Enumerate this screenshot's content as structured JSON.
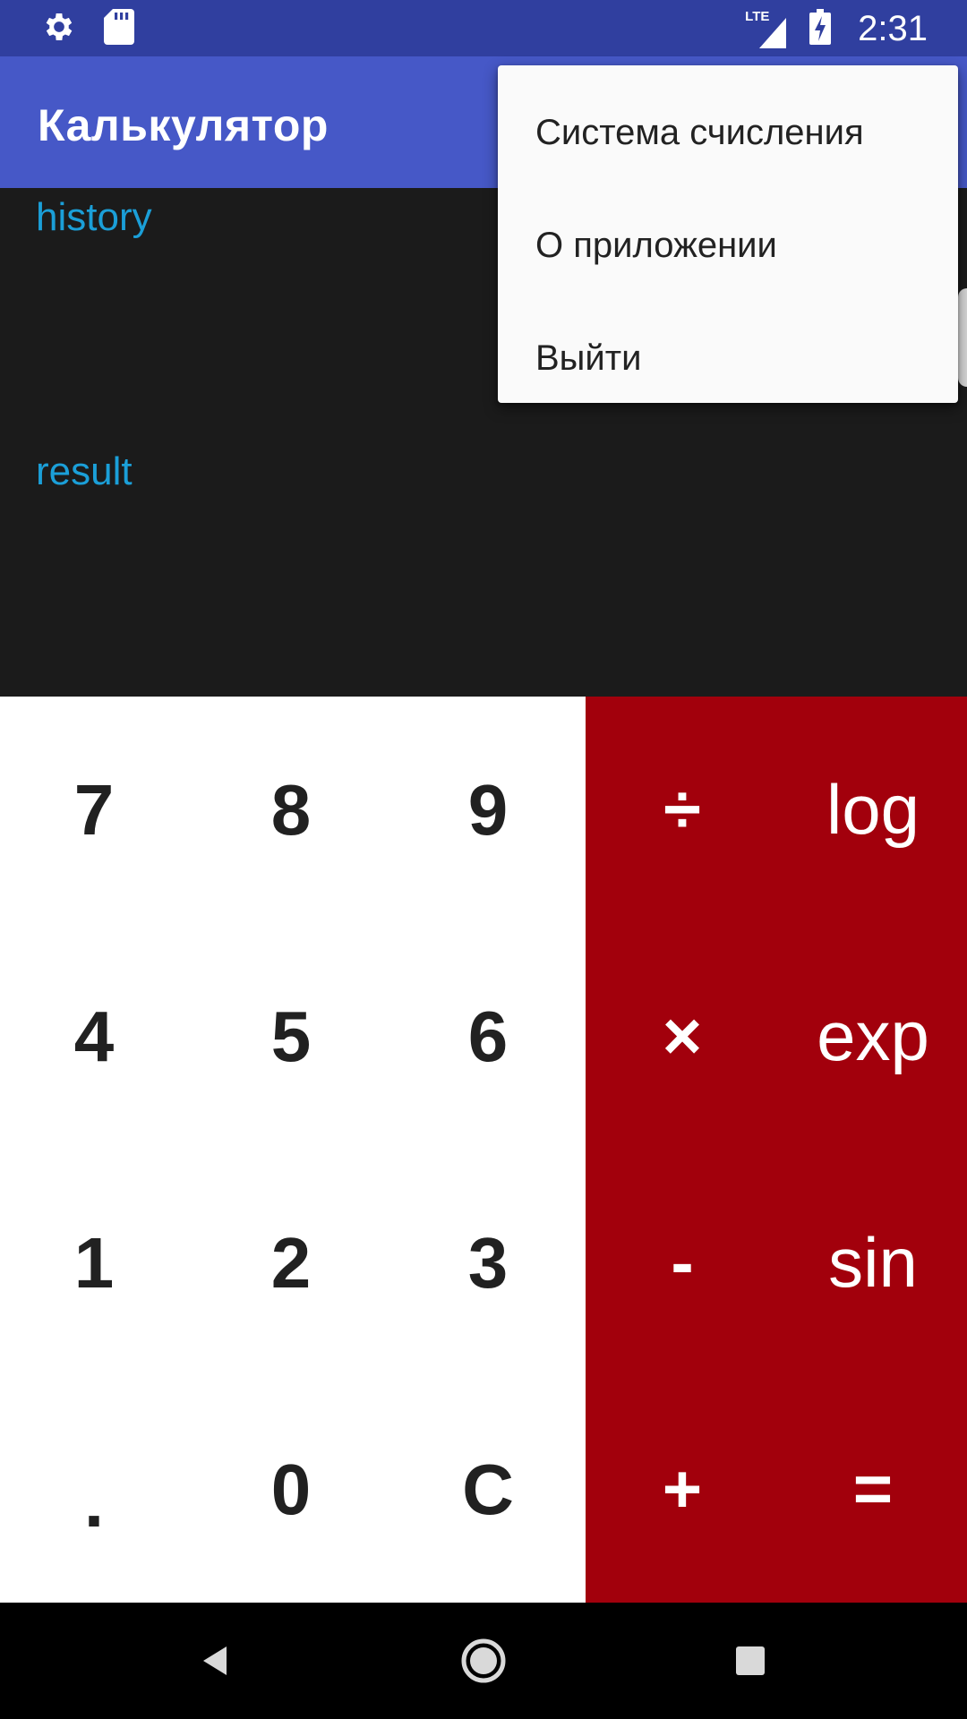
{
  "status_bar": {
    "time": "2:31",
    "network": "LTE",
    "icons": [
      "settings-icon",
      "sd-card-icon",
      "signal-icon",
      "battery-charging-icon"
    ]
  },
  "app_bar": {
    "title": "Калькулятор"
  },
  "display": {
    "history": "history",
    "result": "result"
  },
  "menu": {
    "items": [
      {
        "label": "Система счисления"
      },
      {
        "label": "О приложении"
      },
      {
        "label": "Выйти"
      }
    ]
  },
  "keypad": {
    "digit_keys": [
      "7",
      "8",
      "9",
      "4",
      "5",
      "6",
      "1",
      "2",
      "3",
      ".",
      "0",
      "C"
    ],
    "operator_keys": [
      "÷",
      "×",
      "-",
      "+"
    ],
    "function_keys": [
      "log",
      "exp",
      "sin",
      "="
    ]
  },
  "nav_bar": {
    "icons": [
      "back-icon",
      "home-icon",
      "recents-icon"
    ]
  },
  "colors": {
    "status_bar": "#303f9f",
    "app_bar": "#4658c7",
    "display_bg": "#1b1b1b",
    "label_accent": "#1b9fd8",
    "ops_panel": "#a2000c",
    "digits_panel": "#ffffff"
  }
}
